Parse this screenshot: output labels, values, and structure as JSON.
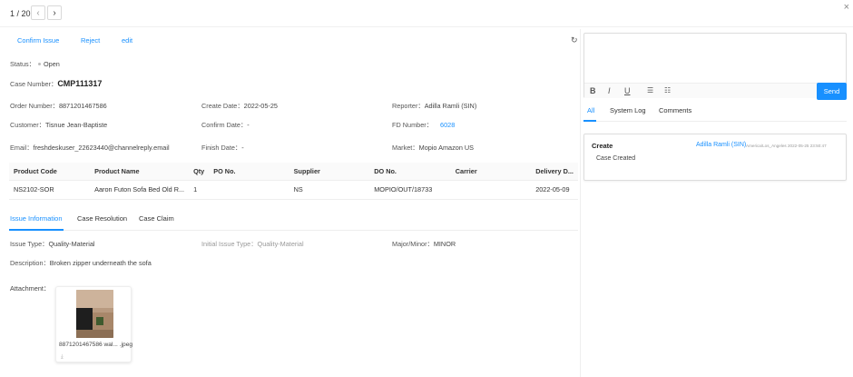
{
  "pager": {
    "text": "1 / 20",
    "prev_icon": "‹",
    "next_icon": "›"
  },
  "close_icon": "×",
  "actions": {
    "confirm": "Confirm Issue",
    "reject": "Reject",
    "edit": "edit"
  },
  "status": {
    "label": "Status：",
    "value": "Open"
  },
  "case_number": {
    "label": "Case Number：",
    "value": "CMP111317"
  },
  "fields": {
    "order_number": {
      "label": "Order Number：",
      "value": "8871201467586"
    },
    "create_date": {
      "label": "Create Date：",
      "value": "2022-05-25"
    },
    "reporter": {
      "label": "Reporter：",
      "value": "Adilla Ramli (SIN)"
    },
    "customer": {
      "label": "Customer：",
      "value": "Tisnue Jean-Baptiste"
    },
    "confirm_date": {
      "label": "Confirm Date：",
      "value": "-"
    },
    "fd_number": {
      "label": "FD Number：",
      "value": "6028"
    },
    "email": {
      "label": "Email：",
      "value": "freshdeskuser_22623440@channelreply.email"
    },
    "finish_date": {
      "label": "Finish Date：",
      "value": "-"
    },
    "market": {
      "label": "Market：",
      "value": "Mopio Amazon US"
    }
  },
  "table": {
    "headers": [
      "Product Code",
      "Product Name",
      "Qty",
      "PO No.",
      "Supplier",
      "DO No.",
      "Carrier",
      "Delivery D..."
    ],
    "rows": [
      [
        "NS2102-SOR",
        "Aaron Futon Sofa Bed Old R...",
        "1",
        "",
        "NS",
        "MOPIO/OUT/18733",
        "",
        "2022-05-09"
      ]
    ]
  },
  "tabs": [
    "Issue Information",
    "Case Resolution",
    "Case Claim"
  ],
  "issue": {
    "issue_type": {
      "label": "Issue Type：",
      "value": "Quality-Material"
    },
    "initial_issue_type": {
      "label": "Initial Issue Type：",
      "value": "Quality-Material"
    },
    "major_minor": {
      "label": "Major/Minor：",
      "value": "MINOR"
    },
    "description": {
      "label": "Description：",
      "value": "Broken zipper underneath the sofa"
    },
    "attachment_label": "Attachment：",
    "attachment_name": "8871201467586 wal... .jpeg",
    "download_icon": "⤓"
  },
  "editor": {
    "bold": "B",
    "italic": "I",
    "underline": "U",
    "bullet_list_icon": "☰",
    "ordered_list_icon": "☷",
    "send": "Send"
  },
  "right_tabs": [
    "All",
    "System Log",
    "Comments"
  ],
  "log": {
    "title": "Create",
    "author": "Adilla Ramli (SIN)",
    "meta": "America/Los_Angeles 2022-05-25 23:50:47",
    "body": "Case Created"
  },
  "colors": {
    "accent": "#1890ff",
    "text": "#333333",
    "border": "#eeeeee"
  }
}
